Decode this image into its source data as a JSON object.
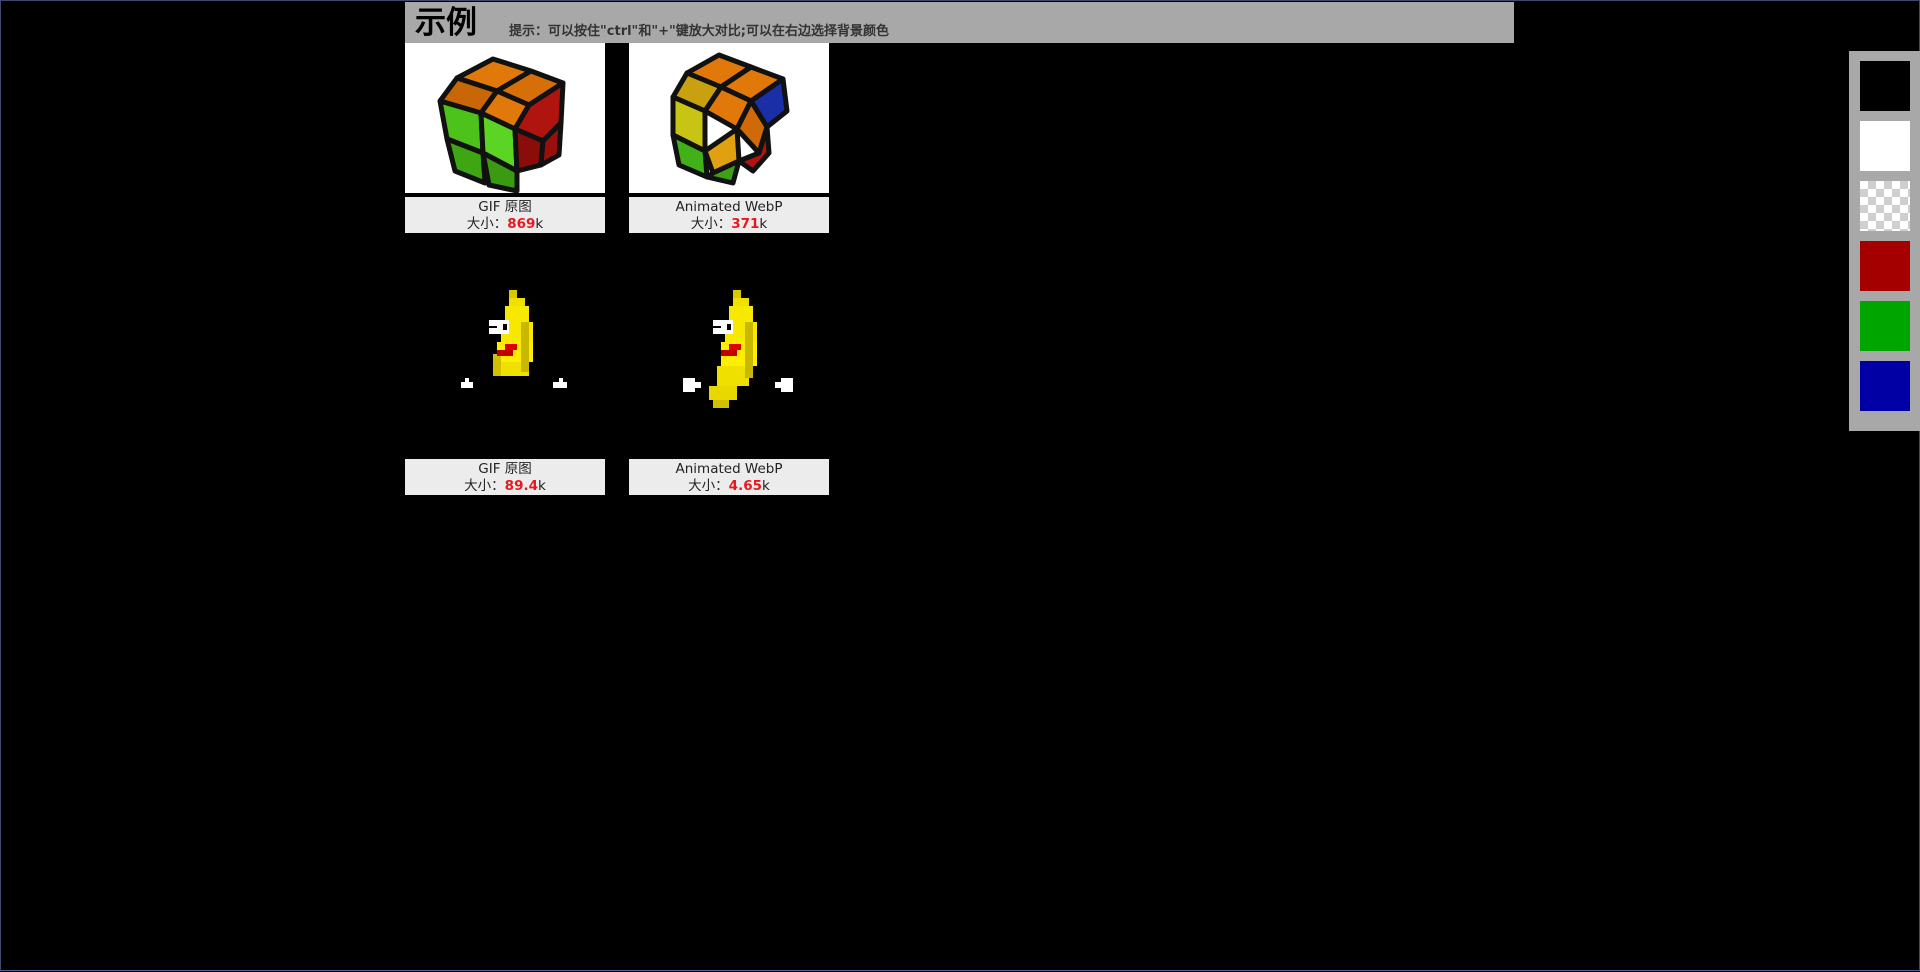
{
  "header": {
    "title": "示例",
    "hint": "提示：可以按住\"ctrl\"和\"+\"键放大对比;可以在右边选择背景颜色"
  },
  "gallery": [
    {
      "label": "GIF 原图",
      "size_label": "大小：",
      "size_value": "869",
      "size_unit": "k",
      "image": "rubiks-cube-gif"
    },
    {
      "label": "Animated WebP",
      "size_label": "大小：",
      "size_value": "371",
      "size_unit": "k",
      "image": "rubiks-cube-webp"
    },
    {
      "label": "GIF 原图",
      "size_label": "大小：",
      "size_value": "89.4",
      "size_unit": "k",
      "image": "dancing-banana-gif"
    },
    {
      "label": "Animated WebP",
      "size_label": "大小：",
      "size_value": "4.65",
      "size_unit": "k",
      "image": "dancing-banana-webp"
    }
  ],
  "background_swatches": [
    {
      "name": "black",
      "color": "#000000"
    },
    {
      "name": "white",
      "color": "#ffffff"
    },
    {
      "name": "transparent",
      "color": "checker"
    },
    {
      "name": "red",
      "color": "#a50000"
    },
    {
      "name": "green",
      "color": "#00a500"
    },
    {
      "name": "blue",
      "color": "#0000a5"
    }
  ],
  "colors": {
    "page_background": "#000000",
    "header_background": "#a8a8a8",
    "caption_background": "#ececec",
    "size_value": "#e5191f"
  }
}
